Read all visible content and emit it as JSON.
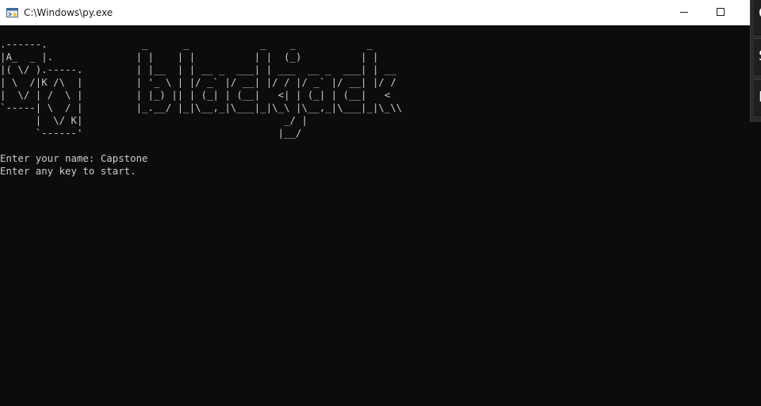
{
  "window": {
    "title": "C:\\Windows\\py.exe",
    "icon": "python-launcher-icon",
    "controls": {
      "minimize_icon": "minimize-icon",
      "maximize_icon": "maximize-icon"
    }
  },
  "console": {
    "ascii_art": ".------.                _      _            _    _            _\n|A_  _ |.              | |    | |          | |  (_)          | |\n|( \\/ ).-----.         | |__  | | __ _  ___| | ___  __ _  ___| | __\n| \\  /|K /\\  |         | '_ \\ | |/ _` |/ __| |/ / |/ _` |/ __| |/ /\n|  \\/ | /  \\ |         | |_) || | (_| | (__|   <| | (_| | (__|   <\n`-----| \\  / |         |_.__/ |_|\\__,_|\\___|_|\\_\\ |\\__,_|\\___|_|\\_\\\\\n      |  \\/ K|                                  _/ |\n      `------'                                 |__/",
    "lines": [
      "Enter your name: Capstone",
      "Enter any key to start."
    ]
  },
  "side_window": {
    "letters": [
      "C",
      "S",
      "F"
    ]
  },
  "colors": {
    "console_bg": "#0c0c0c",
    "console_fg": "#cccccc",
    "titlebar_bg": "#ffffff"
  }
}
